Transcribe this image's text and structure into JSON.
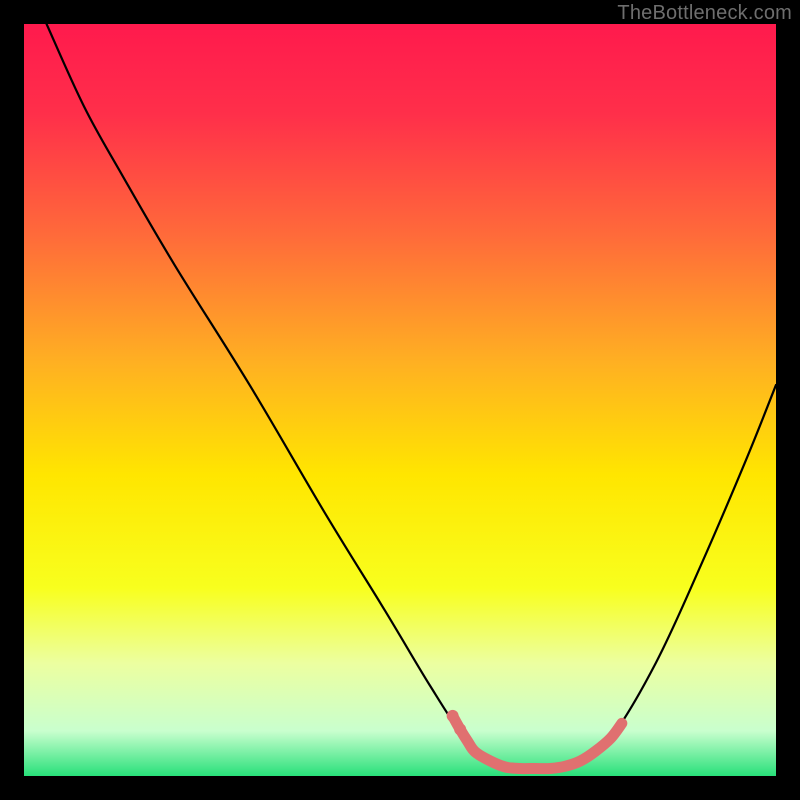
{
  "watermark": "TheBottleneck.com",
  "chart_data": {
    "type": "line",
    "title": "",
    "xlabel": "",
    "ylabel": "",
    "xlim": [
      0,
      100
    ],
    "ylim": [
      0,
      100
    ],
    "background_gradient_stops": [
      {
        "offset": 0.0,
        "color": "#ff1a4d"
      },
      {
        "offset": 0.12,
        "color": "#ff2f4a"
      },
      {
        "offset": 0.28,
        "color": "#ff6a3a"
      },
      {
        "offset": 0.45,
        "color": "#ffb022"
      },
      {
        "offset": 0.6,
        "color": "#ffe600"
      },
      {
        "offset": 0.75,
        "color": "#f8ff1e"
      },
      {
        "offset": 0.85,
        "color": "#ecffa0"
      },
      {
        "offset": 0.94,
        "color": "#c9ffce"
      },
      {
        "offset": 1.0,
        "color": "#28e07a"
      }
    ],
    "series": [
      {
        "name": "bottleneck-curve",
        "color": "#000000",
        "points": [
          {
            "x": 3,
            "y": 100
          },
          {
            "x": 8,
            "y": 89
          },
          {
            "x": 13,
            "y": 80
          },
          {
            "x": 20,
            "y": 68
          },
          {
            "x": 30,
            "y": 52
          },
          {
            "x": 40,
            "y": 35
          },
          {
            "x": 48,
            "y": 22
          },
          {
            "x": 54,
            "y": 12
          },
          {
            "x": 58,
            "y": 6
          },
          {
            "x": 62,
            "y": 2
          },
          {
            "x": 65,
            "y": 1
          },
          {
            "x": 70,
            "y": 1
          },
          {
            "x": 74,
            "y": 2
          },
          {
            "x": 78,
            "y": 5
          },
          {
            "x": 84,
            "y": 15
          },
          {
            "x": 90,
            "y": 28
          },
          {
            "x": 96,
            "y": 42
          },
          {
            "x": 100,
            "y": 52
          }
        ]
      },
      {
        "name": "optimum-highlight",
        "color": "#e07070",
        "points": [
          {
            "x": 57,
            "y": 8
          },
          {
            "x": 58,
            "y": 6.2
          },
          {
            "x": 59,
            "y": 4.6
          },
          {
            "x": 60,
            "y": 3.2
          },
          {
            "x": 62,
            "y": 2
          },
          {
            "x": 64,
            "y": 1.2
          },
          {
            "x": 66,
            "y": 1
          },
          {
            "x": 68,
            "y": 1
          },
          {
            "x": 70,
            "y": 1
          },
          {
            "x": 72,
            "y": 1.3
          },
          {
            "x": 74,
            "y": 2
          },
          {
            "x": 76,
            "y": 3.3
          },
          {
            "x": 78,
            "y": 5
          },
          {
            "x": 79.5,
            "y": 7
          }
        ]
      }
    ]
  }
}
